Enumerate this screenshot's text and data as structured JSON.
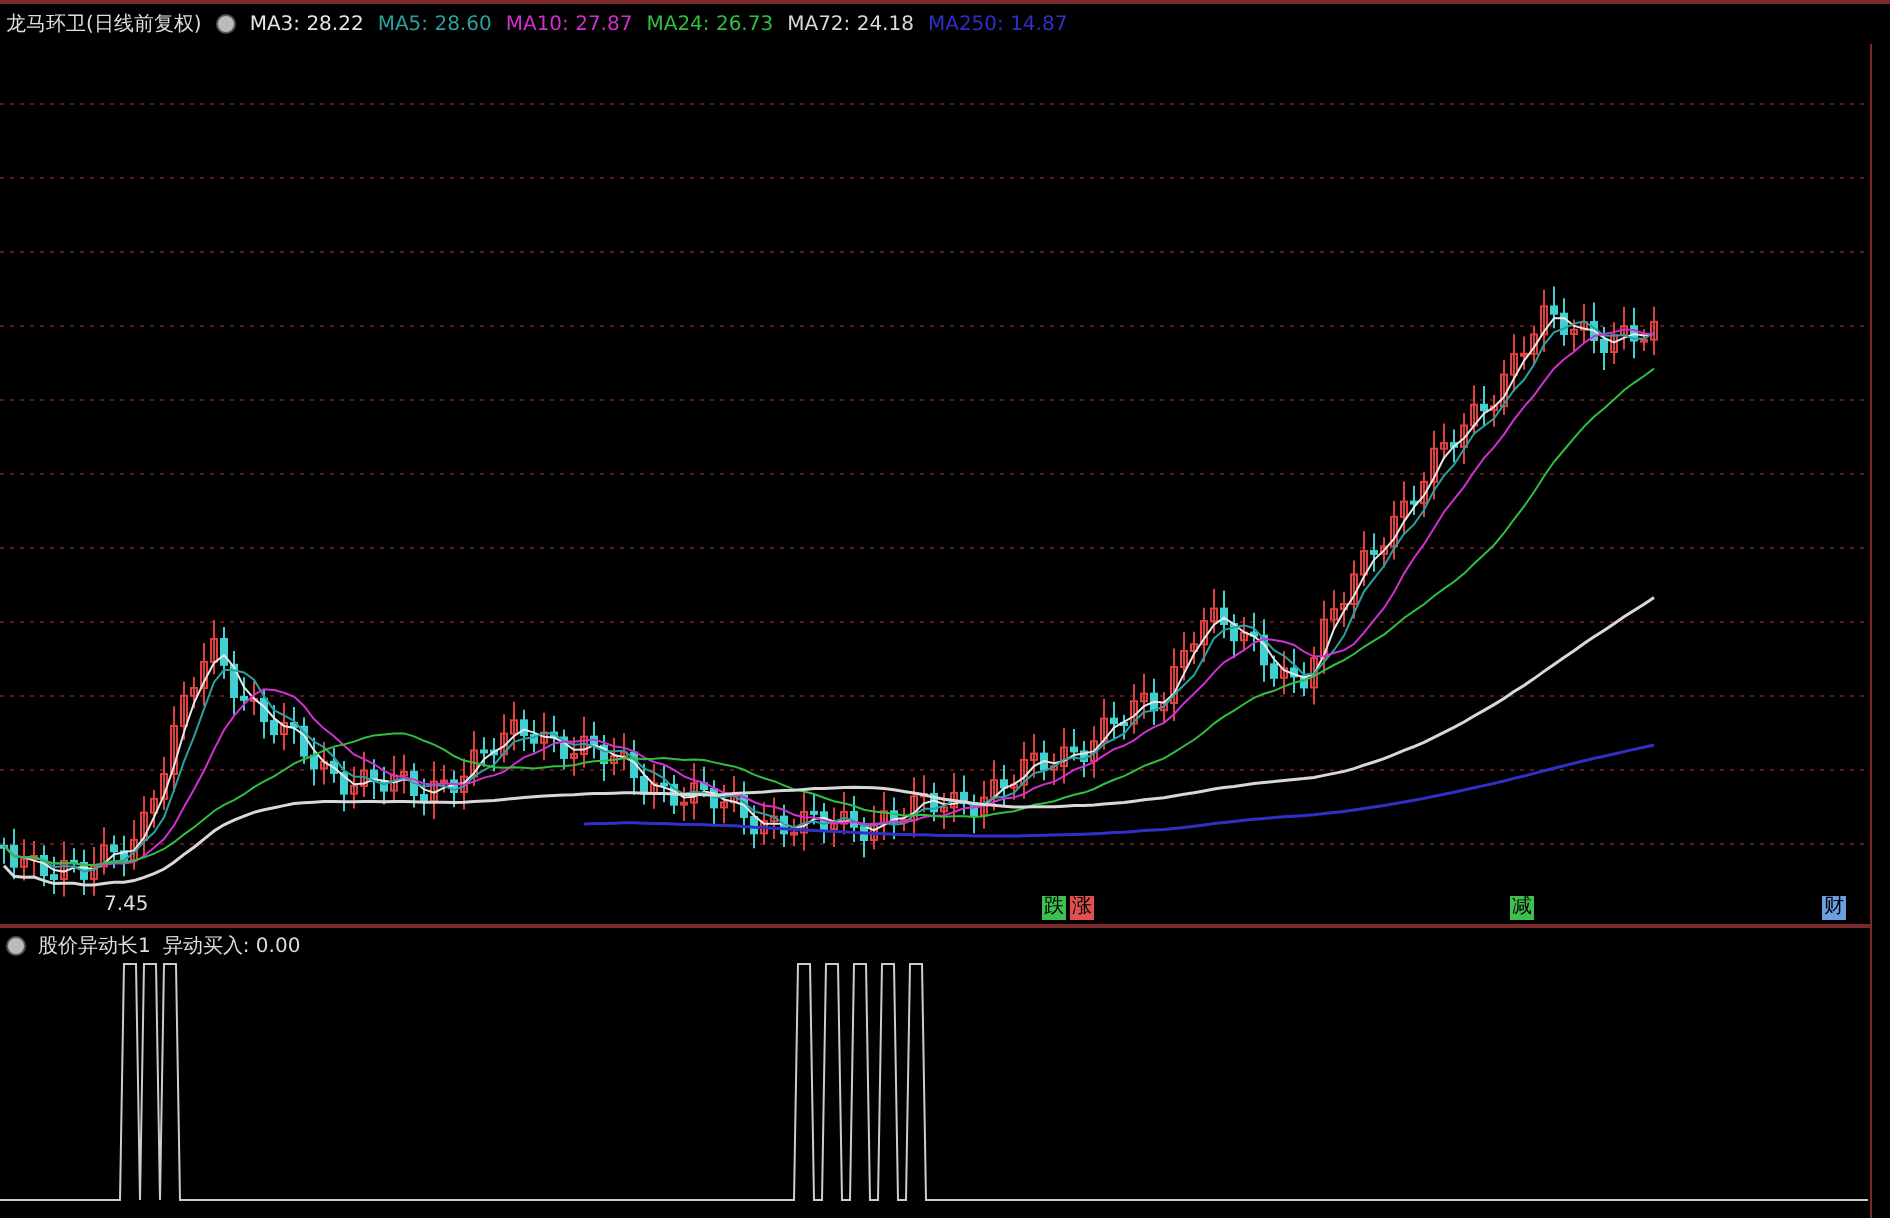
{
  "title": "龙马环卫(日线前复权)",
  "indicators": [
    {
      "label": "MA3: 28.22",
      "color": "#e6e6e6"
    },
    {
      "label": "MA5: 28.60",
      "color": "#2aa0a0"
    },
    {
      "label": "MA10: 27.87",
      "color": "#d030d0"
    },
    {
      "label": "MA24: 26.73",
      "color": "#30c040"
    },
    {
      "label": "MA72: 24.18",
      "color": "#d8d8d8"
    },
    {
      "label": "MA250: 14.87",
      "color": "#3030c8"
    }
  ],
  "price_label": "7.45",
  "event_markers": [
    {
      "text": "跌",
      "color": "#3fbf4f"
    },
    {
      "text": "涨",
      "color": "#e05050"
    },
    {
      "text": "减",
      "color": "#3fbf4f"
    },
    {
      "text": "财",
      "color": "#6aa0e0"
    }
  ],
  "sub_panel": {
    "title": "股价异动长1",
    "reading": "异动买入: 0.00"
  }
}
